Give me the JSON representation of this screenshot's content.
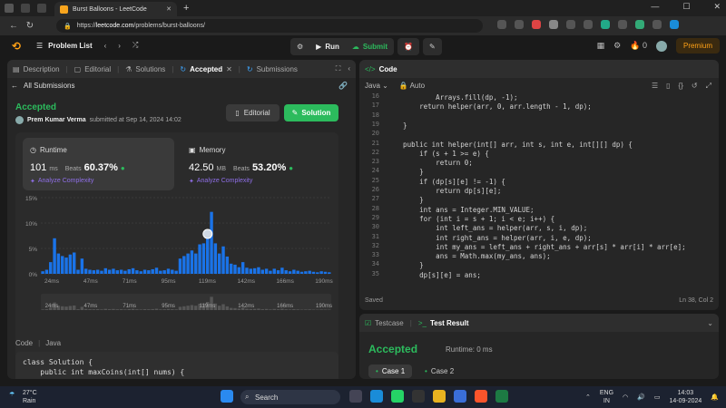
{
  "browser": {
    "tab_title": "Burst Balloons - LeetCode",
    "url_scheme": "https://",
    "url_host": "leetcode.com",
    "url_path": "/problems/burst-balloons/"
  },
  "topbar": {
    "problem_list": "Problem List",
    "run": "Run",
    "submit": "Submit",
    "coins": "0",
    "premium": "Premium"
  },
  "left": {
    "tabs": [
      "Description",
      "Editorial",
      "Solutions",
      "Accepted",
      "Submissions"
    ],
    "all_submissions": "All Submissions",
    "status": "Accepted",
    "author": "Prem Kumar Verma",
    "submitted": "submitted at Sep 14, 2024 14:02",
    "editorial_btn": "Editorial",
    "solution_btn": "Solution",
    "runtime": {
      "label": "Runtime",
      "value": "101",
      "unit": "ms",
      "beats": "Beats",
      "pct": "60.37%",
      "analyze": "Analyze Complexity"
    },
    "memory": {
      "label": "Memory",
      "value": "42.50",
      "unit": "MB",
      "beats": "Beats",
      "pct": "53.20%",
      "analyze": "Analyze Complexity"
    },
    "code_label": "Code",
    "code_lang": "Java",
    "code_line1": "class Solution {",
    "code_line2": "    public int maxCoins(int[] nums) {"
  },
  "chart_data": {
    "type": "bar",
    "ytick_labels": [
      "15%",
      "10%",
      "5%",
      "0%"
    ],
    "ylim": [
      0,
      15
    ],
    "xtick_labels": [
      "24ms",
      "47ms",
      "71ms",
      "95ms",
      "119ms",
      "142ms",
      "166ms",
      "190ms"
    ],
    "values": [
      0.5,
      0.8,
      2.3,
      7.0,
      4.0,
      3.5,
      3.2,
      3.8,
      4.2,
      0.8,
      3.0,
      1.0,
      0.8,
      0.7,
      0.8,
      0.6,
      1.1,
      0.8,
      1.0,
      0.7,
      0.8,
      0.6,
      0.9,
      1.1,
      0.7,
      0.5,
      0.8,
      0.7,
      0.9,
      1.2,
      0.6,
      0.7,
      1.0,
      0.8,
      0.6,
      3.0,
      3.5,
      4.0,
      4.6,
      4.0,
      5.8,
      6.0,
      7.5,
      12.2,
      6.0,
      4.0,
      5.4,
      3.4,
      2.0,
      1.8,
      1.3,
      2.3,
      1.2,
      1.0,
      1.1,
      1.3,
      0.8,
      1.0,
      0.6,
      1.0,
      0.7,
      1.2,
      0.7,
      0.5,
      0.8,
      0.6,
      0.4,
      0.5,
      0.6,
      0.4,
      0.3,
      0.5,
      0.4,
      0.3
    ],
    "highlight_index": 42,
    "grid": true,
    "bar_color": "#1a73e8"
  },
  "editor": {
    "title": "Code",
    "lang": "Java",
    "mode": "Auto",
    "lines": [
      {
        "n": "16",
        "t": "            Arrays.fill(dp, -1);"
      },
      {
        "n": "17",
        "t": "        return helper(arr, 0, arr.length - 1, dp);"
      },
      {
        "n": "18",
        "t": ""
      },
      {
        "n": "19",
        "t": "    }"
      },
      {
        "n": "20",
        "t": ""
      },
      {
        "n": "21",
        "t": "    public int helper(int[] arr, int s, int e, int[][] dp) {"
      },
      {
        "n": "22",
        "t": "        if (s + 1 >= e) {"
      },
      {
        "n": "23",
        "t": "            return 0;"
      },
      {
        "n": "24",
        "t": "        }"
      },
      {
        "n": "25",
        "t": "        if (dp[s][e] != -1) {"
      },
      {
        "n": "26",
        "t": "            return dp[s][e];"
      },
      {
        "n": "27",
        "t": "        }"
      },
      {
        "n": "28",
        "t": "        int ans = Integer.MIN_VALUE;"
      },
      {
        "n": "29",
        "t": "        for (int i = s + 1; i < e; i++) {"
      },
      {
        "n": "30",
        "t": "            int left_ans = helper(arr, s, i, dp);"
      },
      {
        "n": "31",
        "t": "            int right_ans = helper(arr, i, e, dp);"
      },
      {
        "n": "32",
        "t": "            int my_ans = left_ans + right_ans + arr[s] * arr[i] * arr[e];"
      },
      {
        "n": "33",
        "t": "            ans = Math.max(my_ans, ans);"
      },
      {
        "n": "34",
        "t": "        }"
      },
      {
        "n": "35",
        "t": "        dp[s][e] = ans;"
      }
    ],
    "saved": "Saved",
    "position": "Ln 38, Col 2"
  },
  "result": {
    "tab_testcase": "Testcase",
    "tab_result": "Test Result",
    "status": "Accepted",
    "runtime": "Runtime: 0 ms",
    "case1": "Case 1",
    "case2": "Case 2"
  },
  "taskbar": {
    "temp": "27°C",
    "weather": "Rain",
    "search": "Search",
    "lang1": "ENG",
    "lang2": "IN",
    "time": "14:03",
    "date": "14-09-2024"
  }
}
